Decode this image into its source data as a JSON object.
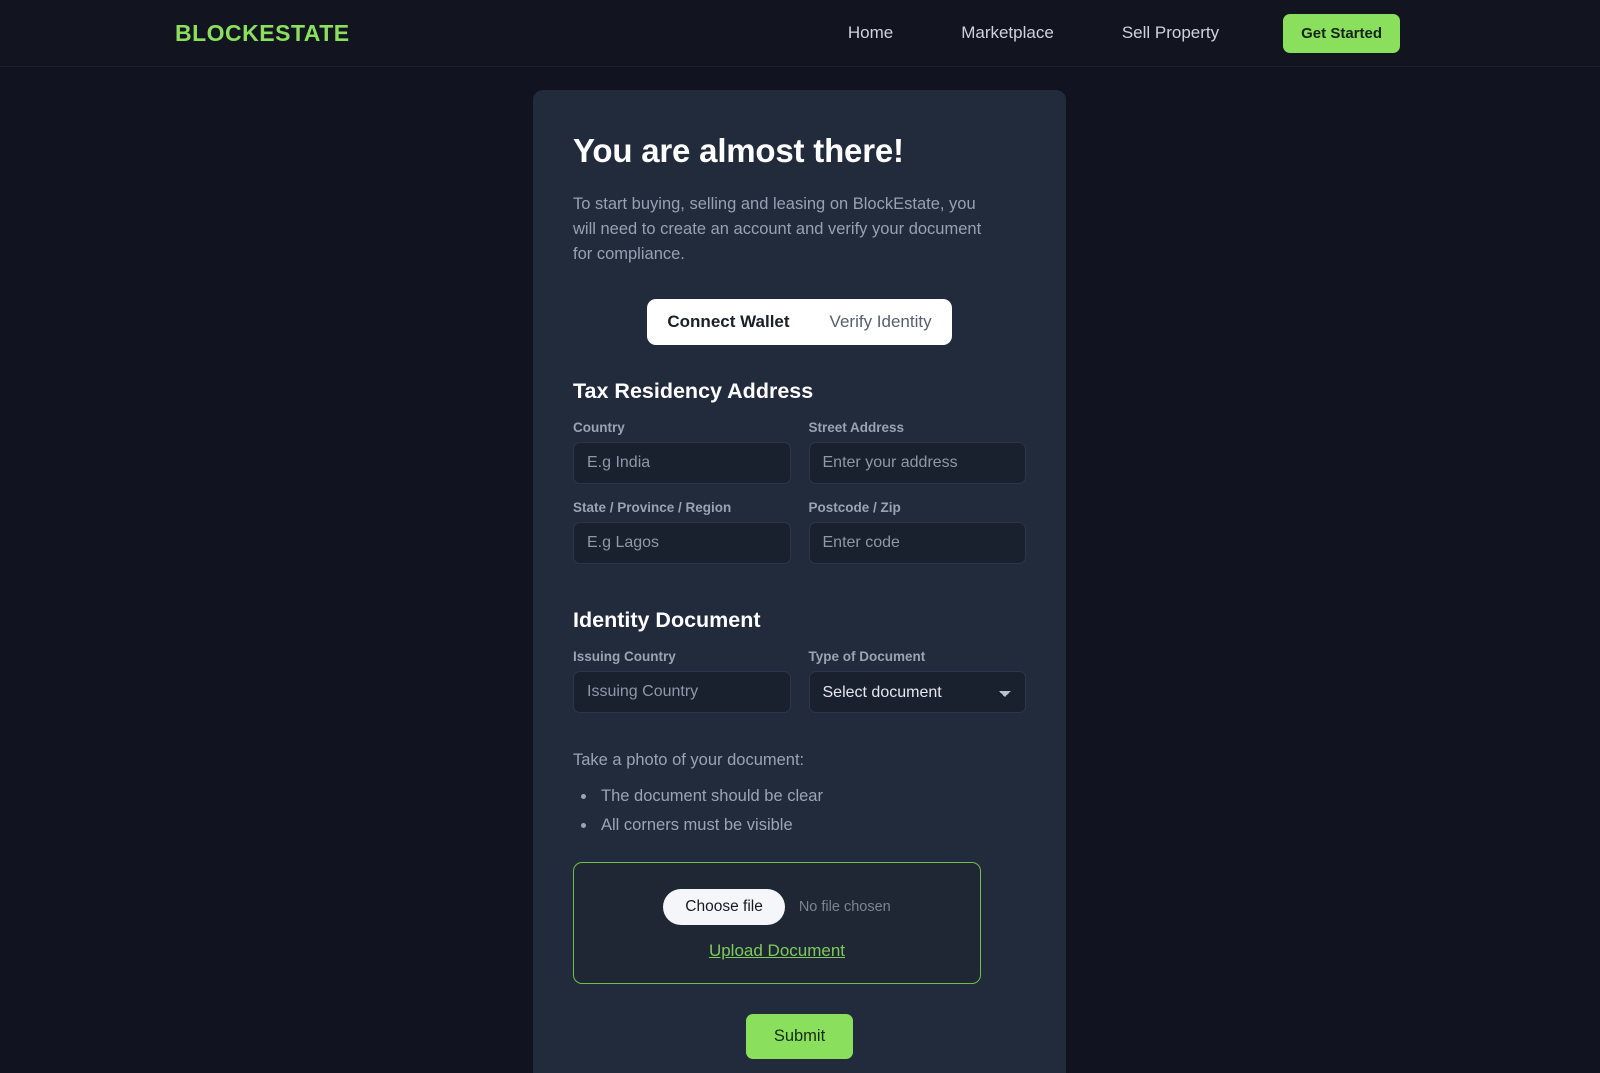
{
  "header": {
    "brand": "BLOCKESTATE",
    "nav": [
      {
        "label": "Home"
      },
      {
        "label": "Marketplace"
      },
      {
        "label": "Sell Property"
      }
    ],
    "cta_label": "Get Started"
  },
  "card": {
    "title": "You are almost there!",
    "subtitle": "To start buying, selling and leasing on BlockEstate, you will need to create an account and verify your document for compliance.",
    "tabs": [
      {
        "label": "Connect Wallet",
        "active": true
      },
      {
        "label": "Verify Identity",
        "active": false
      }
    ],
    "tax_section": {
      "title": "Tax Residency Address",
      "fields": [
        {
          "label": "Country",
          "placeholder": "E.g India",
          "value": ""
        },
        {
          "label": "Street Address",
          "placeholder": "Enter your address",
          "value": ""
        },
        {
          "label": "State / Province / Region",
          "placeholder": "E.g Lagos",
          "value": ""
        },
        {
          "label": "Postcode / Zip",
          "placeholder": "Enter code",
          "value": ""
        }
      ]
    },
    "identity_section": {
      "title": "Identity Document",
      "issuing_country": {
        "label": "Issuing Country",
        "placeholder": "Issuing Country",
        "value": ""
      },
      "document_type": {
        "label": "Type of Document",
        "selected": "Select document",
        "options": [
          "Select document"
        ]
      }
    },
    "photo": {
      "note": "Take a photo of your document:",
      "requirements": [
        "The document should be clear",
        "All corners must be visible"
      ]
    },
    "upload": {
      "choose_file_label": "Choose file",
      "file_status": "No file chosen",
      "link_label": "Upload Document"
    },
    "submit_label": "Submit"
  },
  "colors": {
    "accent_green": "#8ae05c",
    "link_green": "#7ec95a",
    "page_bg": "#111420",
    "card_bg": "#222b3b",
    "input_bg": "#19202e"
  }
}
